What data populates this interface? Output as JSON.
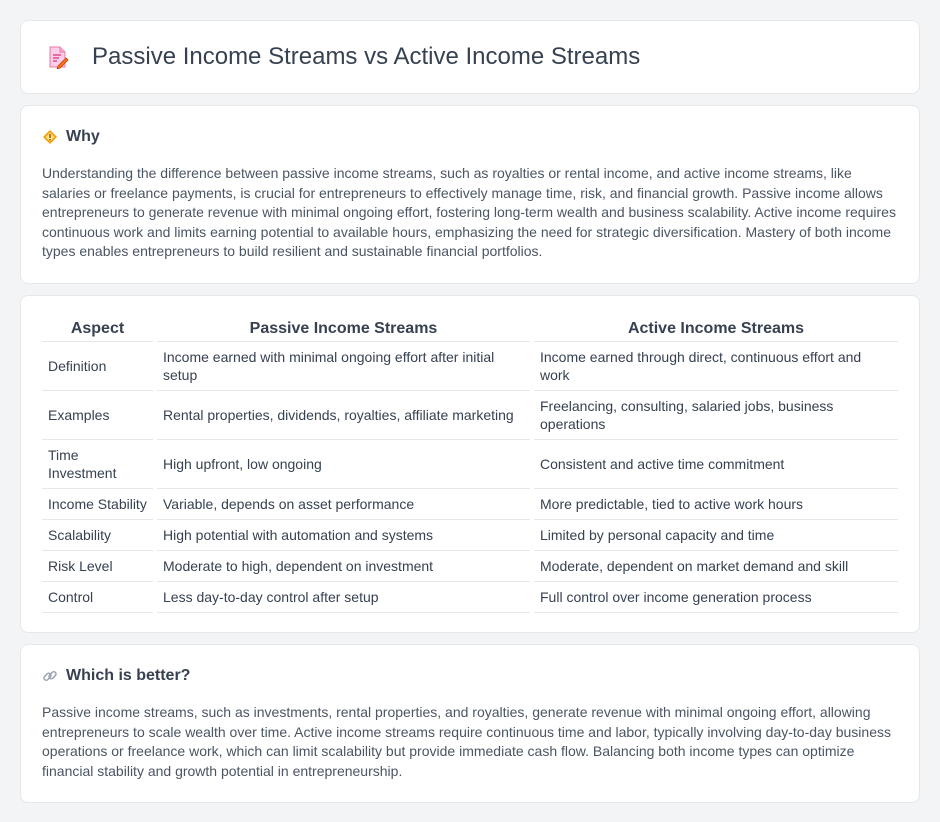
{
  "header": {
    "title": "Passive Income Streams vs Active Income Streams",
    "icon": "document-edit-icon"
  },
  "why": {
    "heading": "Why",
    "icon": "diamond-warning-icon",
    "body": "Understanding the difference between passive income streams, such as royalties or rental income, and active income streams, like salaries or freelance payments, is crucial for entrepreneurs to effectively manage time, risk, and financial growth. Passive income allows entrepreneurs to generate revenue with minimal ongoing effort, fostering long-term wealth and business scalability. Active income requires continuous work and limits earning potential to available hours, emphasizing the need for strategic diversification. Mastery of both income types enables entrepreneurs to build resilient and sustainable financial portfolios."
  },
  "table": {
    "headers": [
      "Aspect",
      "Passive Income Streams",
      "Active Income Streams"
    ],
    "rows": [
      [
        "Definition",
        "Income earned with minimal ongoing effort after initial setup",
        "Income earned through direct, continuous effort and work"
      ],
      [
        "Examples",
        "Rental properties, dividends, royalties, affiliate marketing",
        "Freelancing, consulting, salaried jobs, business operations"
      ],
      [
        "Time Investment",
        "High upfront, low ongoing",
        "Consistent and active time commitment"
      ],
      [
        "Income Stability",
        "Variable, depends on asset performance",
        "More predictable, tied to active work hours"
      ],
      [
        "Scalability",
        "High potential with automation and systems",
        "Limited by personal capacity and time"
      ],
      [
        "Risk Level",
        "Moderate to high, dependent on investment",
        "Moderate, dependent on market demand and skill"
      ],
      [
        "Control",
        "Less day-to-day control after setup",
        "Full control over income generation process"
      ]
    ]
  },
  "better": {
    "heading": "Which is better?",
    "icon": "link-icon",
    "body": "Passive income streams, such as investments, rental properties, and royalties, generate revenue with minimal ongoing effort, allowing entrepreneurs to scale wealth over time. Active income streams require continuous time and labor, typically involving day-to-day business operations or freelance work, which can limit scalability but provide immediate cash flow. Balancing both income types can optimize financial stability and growth potential in entrepreneurship."
  },
  "colors": {
    "background": "#f3f4f6",
    "card": "#ffffff",
    "border": "#e5e7eb",
    "text": "#374151",
    "accent": "#f59e0b"
  }
}
